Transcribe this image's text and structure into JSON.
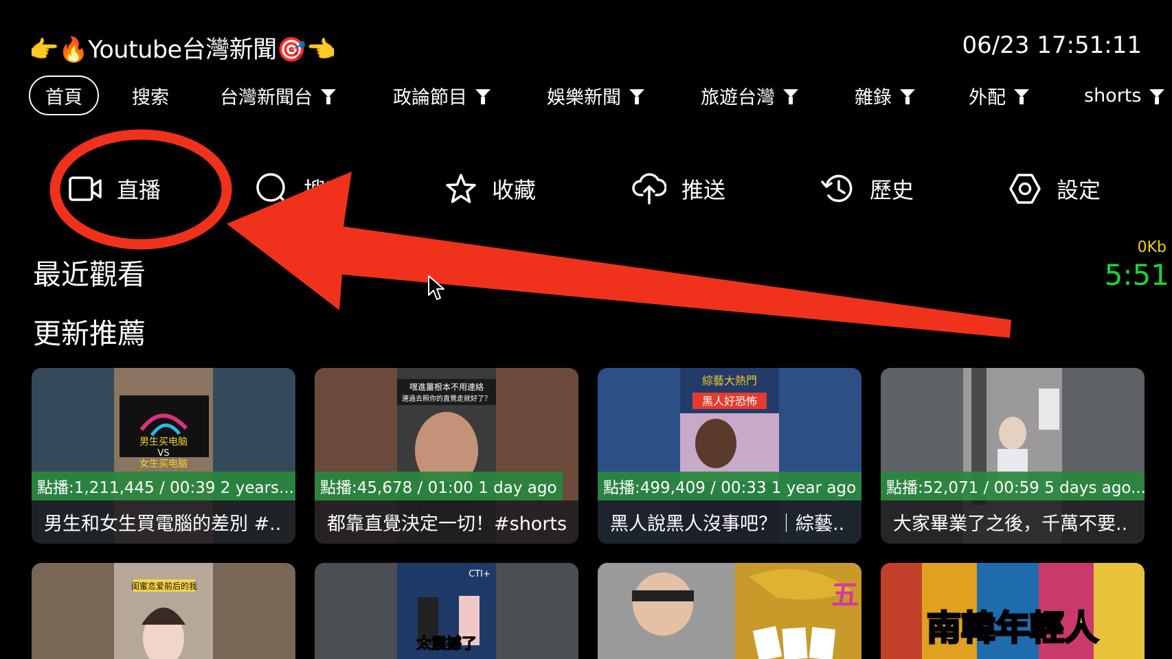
{
  "header": {
    "title": "👉🔥Youtube台灣新聞🎯👈",
    "clock": "06/23 17:51:11"
  },
  "nav": [
    {
      "label": "首頁",
      "filter": false,
      "active": true
    },
    {
      "label": "搜索",
      "filter": false
    },
    {
      "label": "台灣新聞台",
      "filter": true
    },
    {
      "label": "政論節目",
      "filter": true
    },
    {
      "label": "娛樂新聞",
      "filter": true
    },
    {
      "label": "旅遊台灣",
      "filter": true
    },
    {
      "label": "雜錄",
      "filter": true
    },
    {
      "label": "外配",
      "filter": true
    },
    {
      "label": "shorts",
      "filter": true
    }
  ],
  "actions": [
    {
      "label": "直播",
      "icon": "video-camera-icon"
    },
    {
      "label": "搜索",
      "icon": "search-icon"
    },
    {
      "label": "收藏",
      "icon": "star-icon"
    },
    {
      "label": "推送",
      "icon": "cloud-upload-icon"
    },
    {
      "label": "歷史",
      "icon": "history-icon"
    },
    {
      "label": "設定",
      "icon": "settings-icon"
    }
  ],
  "sections": {
    "recent": "最近觀看",
    "recommended": "更新推薦"
  },
  "network": {
    "speed": "0Kb",
    "time": "5:51"
  },
  "videos": [
    {
      "meta": "點播:1,211,445 / 00:39 2 years...",
      "title": "男生和女生買電腦的差別 #..",
      "thumb_text": [
        "男生买电脑",
        "VS",
        "女生买电脑"
      ]
    },
    {
      "meta": "點播:45,678 / 01:00 1 day ago",
      "title": "都靠直覺決定一切！#shorts",
      "thumb_text": [
        "嘿進薑根本不用連絡",
        "連過去照你的直覺走就好了？"
      ]
    },
    {
      "meta": "點播:499,409 / 00:33 1 year ago",
      "title": "黑人說黑人沒事吧？｜綜藝..",
      "thumb_text": [
        "綜藝大熱門",
        "黑人好恐怖"
      ]
    },
    {
      "meta": "點播:52,071 / 00:59 5 days ago...",
      "title": "大家畢業了之後，千萬不要..",
      "thumb_text": []
    }
  ],
  "videos_row2": [
    {
      "thumb_text": [
        "闺蜜恋爱前后的我"
      ]
    },
    {
      "thumb_text": [
        "CTI+",
        "太震撼了"
      ]
    },
    {
      "thumb_text": [
        "五"
      ]
    },
    {
      "thumb_text": [
        "南韓年輕人"
      ]
    }
  ],
  "colors": {
    "background": "#000000",
    "annotation_red": "#f0311c",
    "meta_green": "#2a873e",
    "speed_green": "#18d63a",
    "speed_yellow": "#f5d20a"
  }
}
